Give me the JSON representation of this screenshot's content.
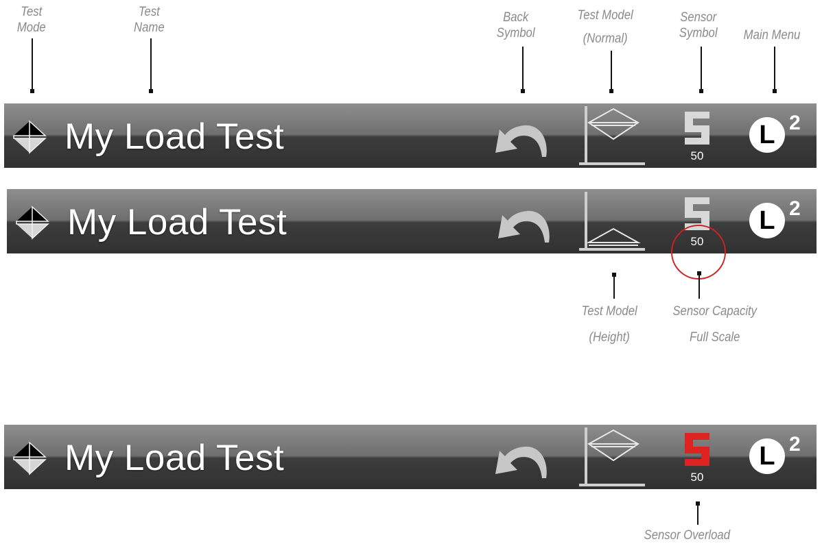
{
  "labels": {
    "test_mode": [
      "Test",
      "Mode"
    ],
    "test_name": [
      "Test",
      "Name"
    ],
    "back_symbol": [
      "Back",
      "Symbol"
    ],
    "test_model_normal": [
      "Test Model",
      "(Normal)"
    ],
    "sensor_symbol": [
      "Sensor",
      "Symbol"
    ],
    "main_menu": [
      "Main Menu"
    ],
    "test_model_height": [
      "Test Model",
      "(Height)"
    ],
    "sensor_capacity": [
      "Sensor Capacity",
      "Full Scale"
    ],
    "sensor_overload": [
      "Sensor Overload"
    ]
  },
  "toolbars": [
    {
      "test_name": "My Load Test",
      "model": "normal",
      "sensor_letter": "S",
      "sensor_capacity": "50",
      "sensor_color": "#d8d8d8",
      "menu_letter": "L",
      "menu_superscript": "2"
    },
    {
      "test_name": "My Load Test",
      "model": "height",
      "sensor_letter": "S",
      "sensor_capacity": "50",
      "sensor_color": "#d8d8d8",
      "menu_letter": "L",
      "menu_superscript": "2"
    },
    {
      "test_name": "My Load Test",
      "model": "normal",
      "sensor_letter": "S",
      "sensor_capacity": "50",
      "sensor_color": "#dd2222",
      "menu_letter": "L",
      "menu_superscript": "2"
    }
  ],
  "icons": {
    "mode": "up-down-triangles-icon",
    "back": "curved-back-arrow-icon",
    "model_normal": "axis-diamond-icon",
    "model_height": "axis-triangle-icon",
    "sensor": "sensor-s-icon",
    "menu": "main-menu-l-icon"
  },
  "colors": {
    "callout_text": "#8a8a8a",
    "overload_red": "#dd2222",
    "highlight_circle": "#d02020"
  }
}
